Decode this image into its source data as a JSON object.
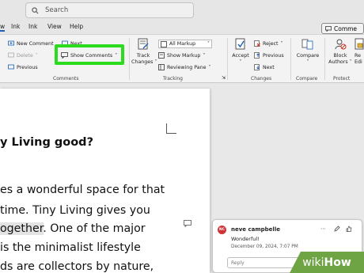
{
  "search": {
    "placeholder": "Search"
  },
  "menubar": {
    "items": [
      "w",
      "Ink",
      "Ink",
      "View",
      "Help"
    ]
  },
  "comments_chip": {
    "label": "Comme"
  },
  "ribbon": {
    "comments_group": {
      "new_comment": "New Comment",
      "next_partial": "Next",
      "delete": "Delete",
      "previous": "Previous",
      "show_comments": "Show Comments",
      "group_label": "Comments"
    },
    "tracking_group": {
      "track_changes_line1": "Track",
      "track_changes_line2": "Changes",
      "markup_select": "All Markup",
      "show_markup": "Show Markup",
      "reviewing_pane": "Reviewing Pane",
      "group_label": "Tracking"
    },
    "changes_group": {
      "accept": "Accept",
      "reject": "Reject",
      "previous": "Previous",
      "next": "Next",
      "group_label": "Changes"
    },
    "compare_group": {
      "compare": "Compare",
      "group_label": "Compare"
    },
    "protect_group": {
      "block_authors_line1": "Block",
      "block_authors_line2": "Authors",
      "restrict_line1": "Re",
      "restrict_line2": "Edi",
      "group_label": "Protect"
    }
  },
  "document": {
    "heading": "y Living good?",
    "lines": [
      "es a wonderful space for that",
      " time. Tiny Living gives you",
      "ogether. One of the major",
      "is the minimalist lifestyle",
      "ds are collectors by nature,"
    ]
  },
  "comment": {
    "initials": "NC",
    "author": "neve campbelle",
    "text": "Wonderful!",
    "date": "December 09, 2024, 7:07 PM",
    "reply_placeholder": "Reply"
  },
  "watermark": {
    "brand1": "wiki",
    "brand2": "How"
  },
  "colors": {
    "highlight": "#2bdc1e",
    "avatar": "#d13438",
    "watermark": "#6fa444",
    "accent": "#1a5fb4"
  }
}
